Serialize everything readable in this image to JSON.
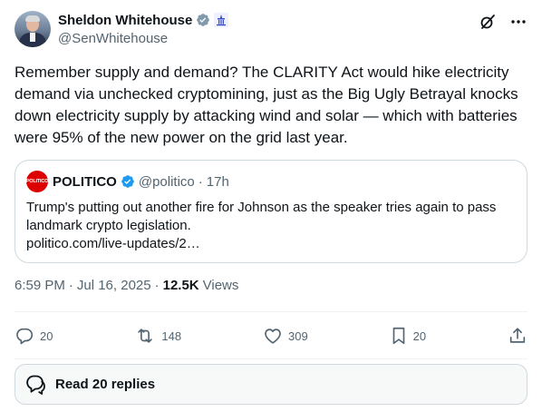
{
  "author": {
    "display_name": "Sheldon Whitehouse",
    "handle": "@SenWhitehouse"
  },
  "tweet": {
    "text": "Remember supply and demand? The CLARITY Act would hike electricity demand via unchecked cryptomining, just as the Big Ugly Betrayal knocks down electricity supply by attacking wind and solar — which with batteries were 95% of the new power on the grid last year."
  },
  "quote": {
    "logo_text": "POLITICO",
    "name": "POLITICO",
    "handle": "@politico",
    "dot": "·",
    "time": "17h",
    "text_line1": "Trump's putting out another fire for Johnson as the speaker tries again to pass",
    "text_line2": "landmark crypto legislation.",
    "link": "politico.com/live-updates/2…"
  },
  "meta": {
    "time": "6:59 PM",
    "sep": "·",
    "date": "Jul 16, 2025",
    "views_count": "12.5K",
    "views_label": "Views"
  },
  "actions": {
    "replies": "20",
    "reposts": "148",
    "likes": "309",
    "bookmarks": "20"
  },
  "read_replies": {
    "label": "Read 20 replies"
  },
  "colors": {
    "text_primary": "#0f1419",
    "text_secondary": "#536471",
    "border": "#cfd9de",
    "verified_blue": "#1d9bf0",
    "verified_gray": "#829aab",
    "politico_red": "#dc0000"
  },
  "icons": [
    "verified-badge-icon",
    "capitol-affiliation-icon",
    "grok-icon",
    "more-icon",
    "reply-icon",
    "repost-icon",
    "like-icon",
    "bookmark-icon",
    "share-icon",
    "chat-bubbles-icon"
  ]
}
